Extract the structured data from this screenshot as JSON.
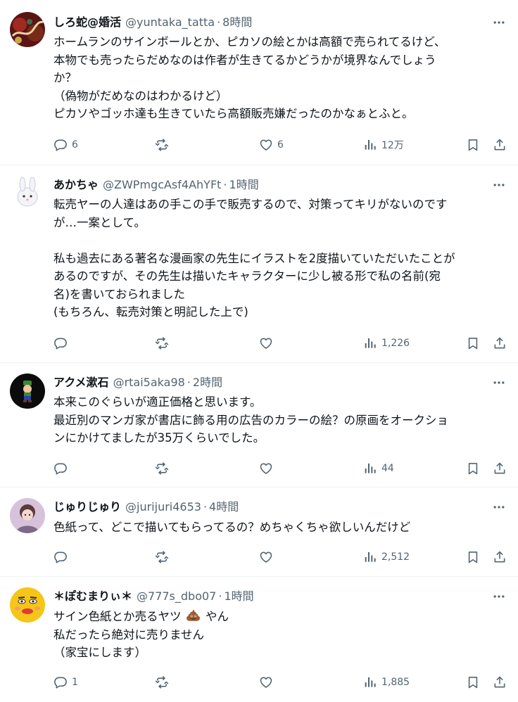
{
  "tweets": [
    {
      "name": "しろ蛇@婚活",
      "handle": "@yuntaka_tatta",
      "dot": "·",
      "time": "8時間",
      "lines": [
        "ホームランのサインボールとか、ピカソの絵とかは高額で売られてるけど、",
        "本物でも売ったらだめなのは作者が生きてるかどうかが境界なんでしょう",
        "か？",
        "（偽物がだめなのはわかるけど）",
        "ピカソやゴッホ達も生きていたら高額販売嫌だったのかなぁとふと。"
      ],
      "replies": "6",
      "retweets": "",
      "likes": "6",
      "views": "12万",
      "avatar_color": "#7a1d1d"
    },
    {
      "name": "あかちゃ",
      "handle": "@ZWPmgcAsf4AhYFt",
      "dot": "·",
      "time": "1時間",
      "lines": [
        "転売ヤーの人達はあの手この手で販売するので、対策ってキリがないのです",
        "が…一案として。",
        "",
        "私も過去にある著名な漫画家の先生にイラストを2度描いていただいたことが",
        "あるのですが、その先生は描いたキャラクターに少し被る形で私の名前(宛",
        "名)を書いておられました",
        "(もちろん、転売対策と明記した上で)"
      ],
      "replies": "",
      "retweets": "",
      "likes": "",
      "views": "1,226",
      "avatar_color": "#ffffff"
    },
    {
      "name": "アクメ漱石",
      "handle": "@rtai5aka98",
      "dot": "·",
      "time": "2時間",
      "lines": [
        "本来このぐらいが適正価格と思います。",
        "最近別のマンガ家が書店に飾る用の広告のカラーの絵？の原画をオークショ",
        "ンにかけてましたが35万くらいでした。"
      ],
      "replies": "",
      "retweets": "",
      "likes": "",
      "views": "44",
      "avatar_color": "#111111"
    },
    {
      "name": "じゅりじゅり",
      "handle": "@jurijuri4653",
      "dot": "·",
      "time": "4時間",
      "lines": [
        "色紙って、どこで描いてもらってるの？めちゃくちゃ欲しいんだけど"
      ],
      "replies": "",
      "retweets": "",
      "likes": "",
      "views": "2,512",
      "avatar_color": "#c9a9c9"
    },
    {
      "name": "＊ぽむまりぃ＊",
      "handle": "@777s_dbo07",
      "dot": "·",
      "time": "1時間",
      "lines_parts": [
        {
          "before": "サイン色紙とか売るヤツ",
          "emoji": "pile-of-poo",
          "after": "やん"
        }
      ],
      "lines": [
        "私だったら絶対に売りません",
        "（家宝にします）"
      ],
      "replies": "1",
      "retweets": "",
      "likes": "",
      "views": "1,885",
      "avatar_color": "#f5c518"
    }
  ],
  "icons": {
    "more": "more-horizontal-icon",
    "reply": "reply-icon",
    "retweet": "retweet-icon",
    "like": "heart-icon",
    "views": "views-icon",
    "bookmark": "bookmark-icon",
    "share": "share-icon"
  },
  "colors": {
    "text": "#0f1419",
    "secondary": "#536471",
    "divider": "#eff3f4"
  }
}
